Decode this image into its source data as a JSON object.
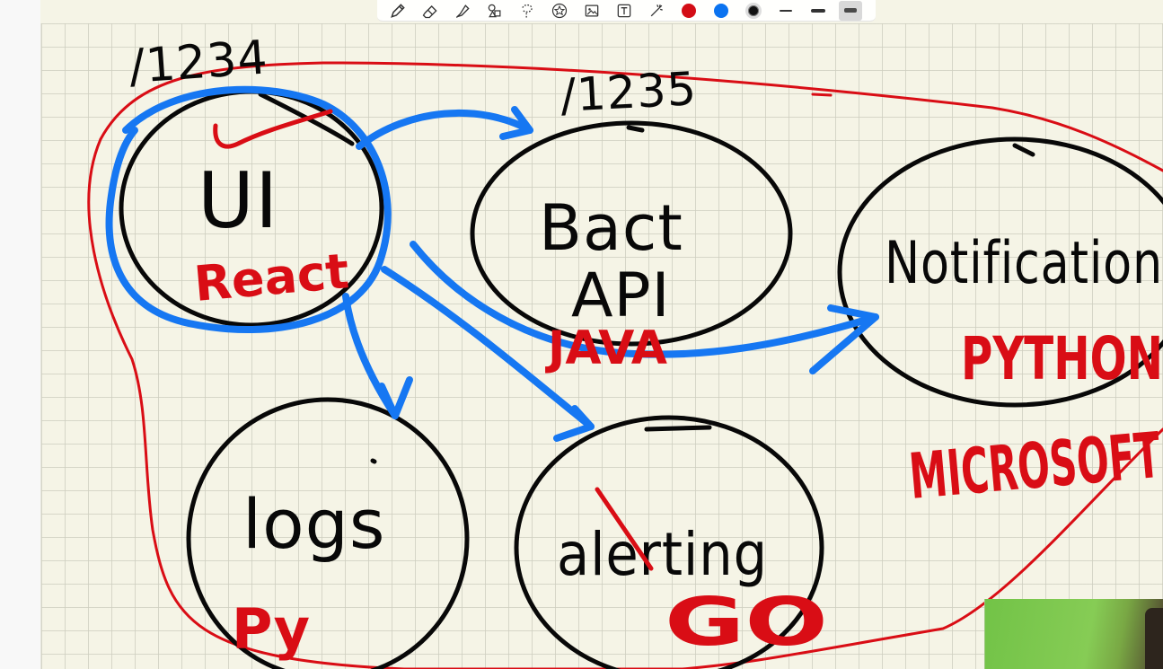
{
  "toolbar": {
    "tools": [
      {
        "name": "pen-tool",
        "icon": "pen-icon"
      },
      {
        "name": "eraser-tool",
        "icon": "eraser-icon"
      },
      {
        "name": "highlighter-tool",
        "icon": "highlighter-icon"
      },
      {
        "name": "shape-tool",
        "icon": "shapes-icon"
      },
      {
        "name": "lasso-tool",
        "icon": "lasso-icon"
      },
      {
        "name": "sticker-tool",
        "icon": "star-icon"
      },
      {
        "name": "image-tool",
        "icon": "image-icon"
      },
      {
        "name": "text-tool",
        "icon": "text-box-icon"
      },
      {
        "name": "laser-pointer-tool",
        "icon": "laser-pointer-icon"
      }
    ],
    "colors": [
      "#d30d15",
      "#0b73f0",
      "#111111"
    ],
    "selected_color": "#111111",
    "stroke_widths": [
      "thin",
      "medium",
      "thick"
    ],
    "selected_stroke_width": "thick"
  },
  "canvas": {
    "background": "#f5f4e6",
    "grid_color": "#cdcdbe",
    "ink_colors": {
      "black": "#080808",
      "red": "#d90d15",
      "blue": "#1677f2"
    }
  },
  "handwriting": {
    "top_left_number": "/1234",
    "top_mid_number": "/1235",
    "ui_node": "UI",
    "ui_stack": "React",
    "backend_node": "Bact",
    "backend_api": "API",
    "backend_stack": "JAVA",
    "notification_node": "Notification",
    "notification_stack": "PYTHON",
    "logs_node": "logs",
    "logs_stack": "Py",
    "alerting_node": "alerting",
    "alerting_stack": "GO",
    "cloud_label": "MICROSOFT"
  }
}
